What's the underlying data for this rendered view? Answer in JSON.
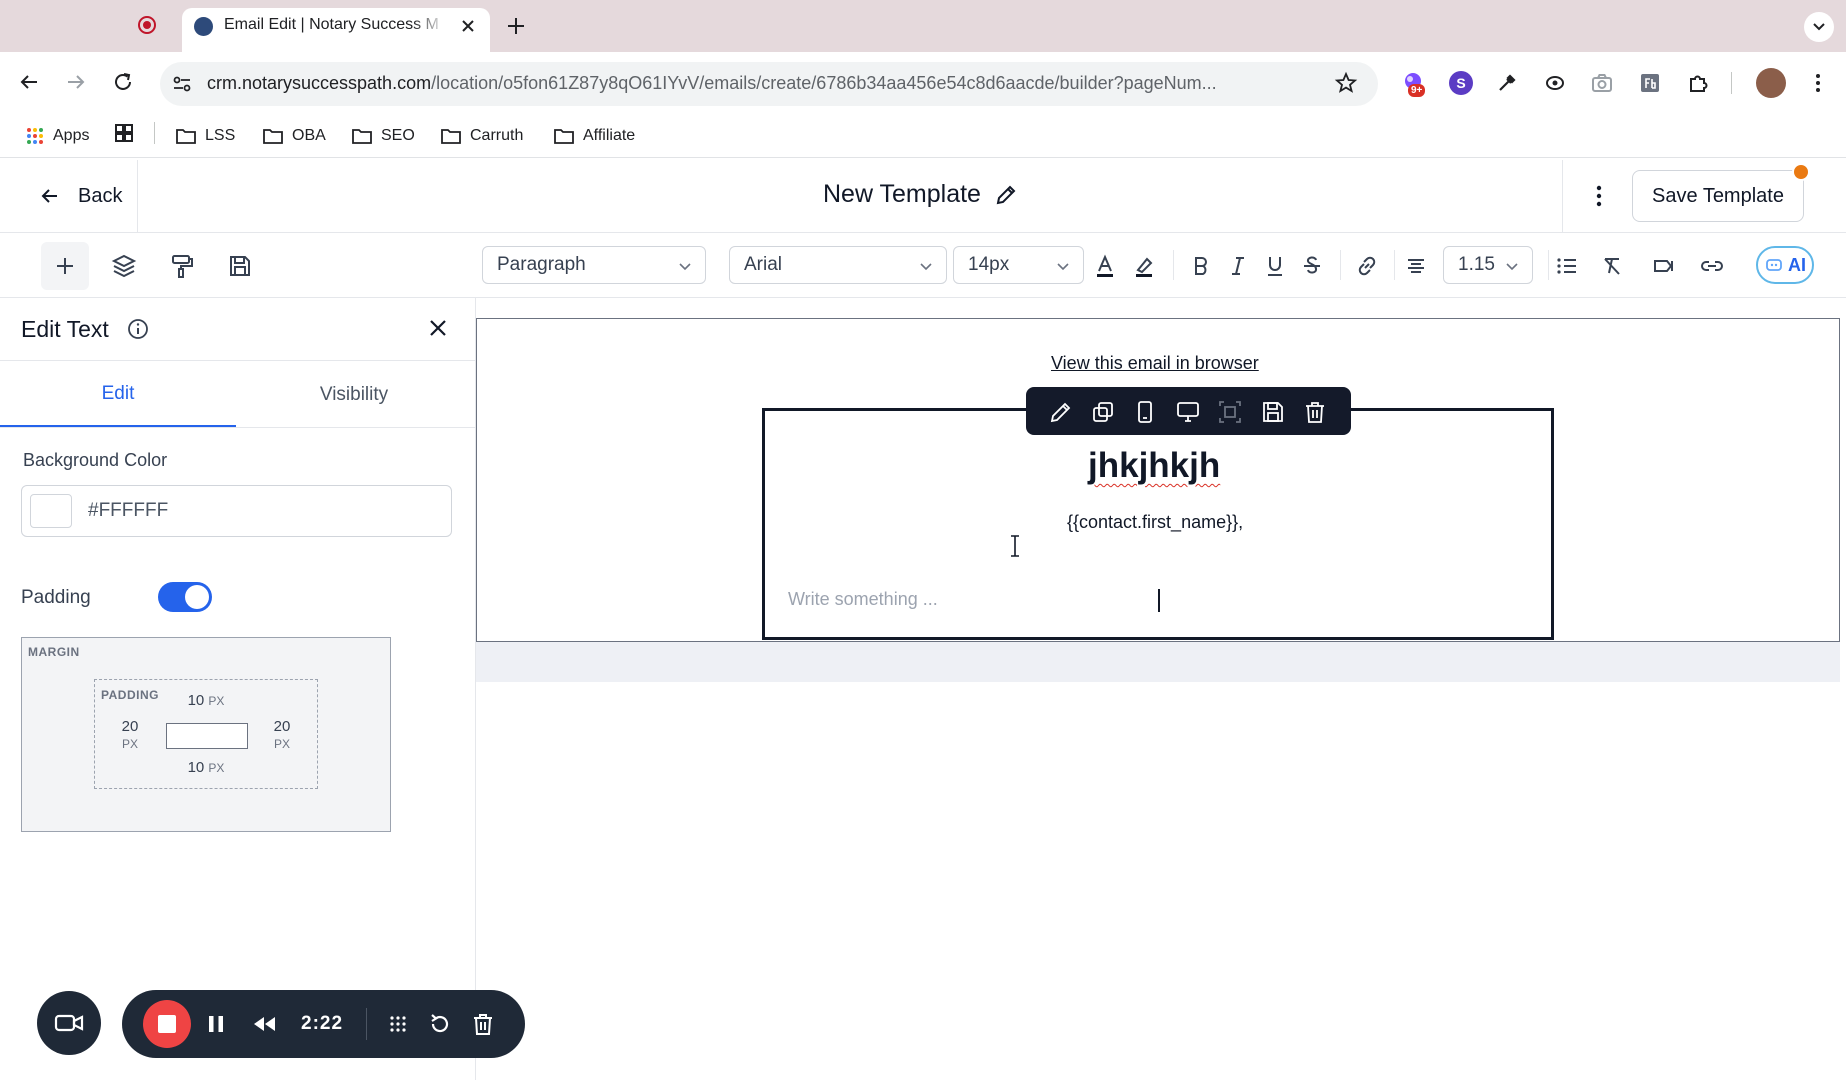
{
  "browser": {
    "active_tab_title": "Email Edit | Notary Success M",
    "url_host": "crm.notarysuccesspath.com",
    "url_path": "/location/o5fon61Z87y8qO61IYvV/emails/create/6786b34aa456e54c8d6aacde/builder?pageNum...",
    "extension_badge": "9+",
    "extension_s_label": "S",
    "bookmarks": [
      "Apps",
      "LSS",
      "OBA",
      "SEO",
      "Carruth",
      "Affiliate"
    ]
  },
  "header": {
    "back_label": "Back",
    "template_title": "New Template",
    "save_label": "Save Template"
  },
  "format_bar": {
    "block_type": "Paragraph",
    "font_family": "Arial",
    "font_size": "14px",
    "line_height": "1.15",
    "ai_label": "AI"
  },
  "panel": {
    "title": "Edit Text",
    "tabs": [
      {
        "label": "Edit",
        "active": true
      },
      {
        "label": "Visibility",
        "active": false
      }
    ],
    "background_color_label": "Background Color",
    "background_color_value": "#FFFFFF",
    "padding_label": "Padding",
    "padding_enabled": true,
    "box_model": {
      "margin_label": "MARGIN",
      "padding_label": "PADDING",
      "top": "10",
      "bottom": "10",
      "left": "20",
      "right": "20",
      "unit": "PX"
    }
  },
  "email": {
    "view_in_browser": "View this email in browser",
    "heading": "jhkjhkjh",
    "merge_tag": "{{contact.first_name}},",
    "placeholder": "Write something ..."
  },
  "recorder": {
    "elapsed": "2:22"
  },
  "colors": {
    "accent": "#2563eb",
    "recorder_stop": "#ef4444",
    "unsaved_indicator": "#ea7a12",
    "floating_toolbar": "#141a2a"
  }
}
